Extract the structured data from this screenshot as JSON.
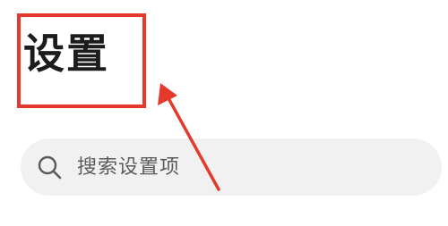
{
  "header": {
    "title": "设置"
  },
  "search": {
    "placeholder": "搜索设置项",
    "icon": "search-icon"
  },
  "annotation": {
    "highlight_color": "#e53a2b",
    "arrow_color": "#e53a2b"
  }
}
